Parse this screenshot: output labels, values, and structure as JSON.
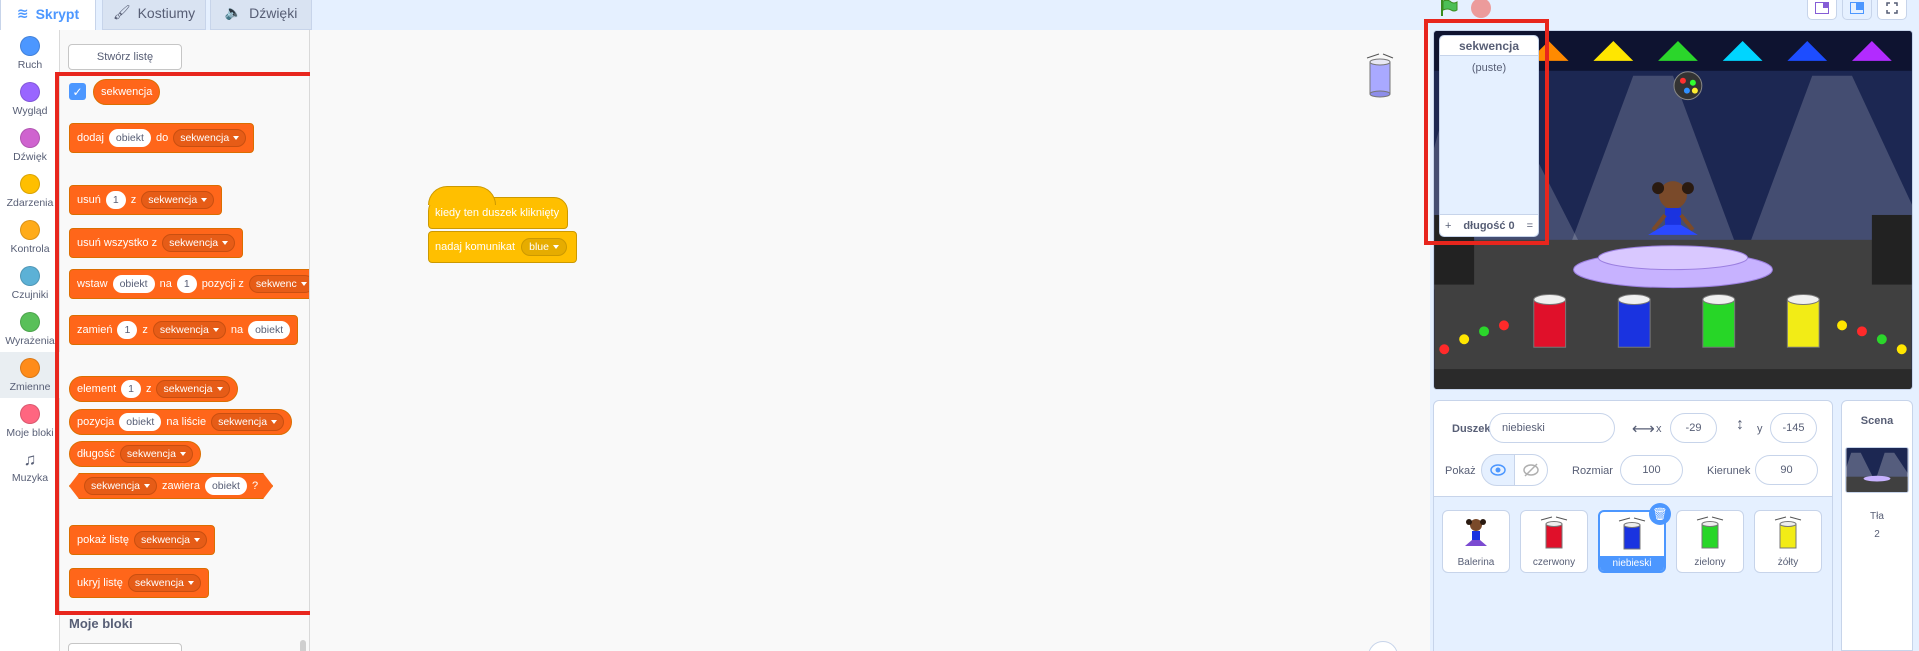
{
  "tabs": [
    {
      "label": "Skrypt",
      "icon": "code-icon",
      "active": true
    },
    {
      "label": "Kostiumy",
      "icon": "brush-icon",
      "active": false
    },
    {
      "label": "Dźwięki",
      "icon": "speaker-icon",
      "active": false
    }
  ],
  "categories": [
    {
      "label": "Ruch",
      "color": "#4c97ff"
    },
    {
      "label": "Wygląd",
      "color": "#9966ff"
    },
    {
      "label": "Dźwięk",
      "color": "#cf63cf"
    },
    {
      "label": "Zdarzenia",
      "color": "#ffbf00"
    },
    {
      "label": "Kontrola",
      "color": "#ffab19"
    },
    {
      "label": "Czujniki",
      "color": "#5cb1d6"
    },
    {
      "label": "Wyrażenia",
      "color": "#59c059"
    },
    {
      "label": "Zmienne",
      "color": "#ff8c1a"
    },
    {
      "label": "Moje bloki",
      "color": "#ff6680"
    },
    {
      "label": "Muzyka",
      "icon": "music-note-icon"
    }
  ],
  "palette": {
    "make_list": "Stwórz listę",
    "list_reporter": "sekwencja",
    "my_blocks_heading": "Moje bloki",
    "blocks": {
      "add": {
        "w1": "dodaj",
        "f1": "obiekt",
        "w2": "do",
        "d1": "sekwencja"
      },
      "delete": {
        "w1": "usuń",
        "f1": "1",
        "w2": "z",
        "d1": "sekwencja"
      },
      "delete_all": {
        "w1": "usuń wszystko z",
        "d1": "sekwencja"
      },
      "insert": {
        "w1": "wstaw",
        "f1": "obiekt",
        "w2": "na",
        "f2": "1",
        "w3": "pozycji z",
        "d1": "sekwenc"
      },
      "replace": {
        "w1": "zamień",
        "f1": "1",
        "w2": "z",
        "d1": "sekwencja",
        "w3": "na",
        "f2": "obiekt"
      },
      "item": {
        "w1": "element",
        "f1": "1",
        "w2": "z",
        "d1": "sekwencja"
      },
      "item_num": {
        "w1": "pozycja",
        "f1": "obiekt",
        "w2": "na liście",
        "d1": "sekwencja"
      },
      "length": {
        "w1": "długość",
        "d1": "sekwencja"
      },
      "contains": {
        "d1": "sekwencja",
        "w1": "zawiera",
        "f1": "obiekt",
        "w2": "?"
      },
      "show": {
        "w1": "pokaż listę",
        "d1": "sekwencja"
      },
      "hide": {
        "w1": "ukryj listę",
        "d1": "sekwencja"
      }
    }
  },
  "script": {
    "hat": "kiedy ten duszek kliknięty",
    "broadcast_label": "nadaj komunikat",
    "broadcast_value": "blue"
  },
  "list_monitor": {
    "title": "sekwencja",
    "empty": "(puste)",
    "add": "+",
    "length": "długość 0",
    "resize": "="
  },
  "sprite_info": {
    "sprite_label": "Duszek",
    "sprite_name": "niebieski",
    "x_label": "x",
    "x_value": "-29",
    "y_label": "y",
    "y_value": "-145",
    "show_label": "Pokaż",
    "size_label": "Rozmiar",
    "size_value": "100",
    "direction_label": "Kierunek",
    "direction_value": "90"
  },
  "sprites": [
    {
      "name": "Balerina",
      "color": "#7b4ad1",
      "selected": false
    },
    {
      "name": "czerwony",
      "color": "#e0102a",
      "selected": false
    },
    {
      "name": "niebieski",
      "color": "#1a33e0",
      "selected": true
    },
    {
      "name": "zielony",
      "color": "#27d627",
      "selected": false
    },
    {
      "name": "żółty",
      "color": "#f2ec16",
      "selected": false
    }
  ],
  "stage_panel": {
    "title": "Scena",
    "backdrops_label": "Tła",
    "backdrops_count": "2"
  },
  "colors": {
    "variables": "#ff661a",
    "events": "#ffbf00",
    "highlight": "#e8261d",
    "accent": "#4c97ff"
  }
}
